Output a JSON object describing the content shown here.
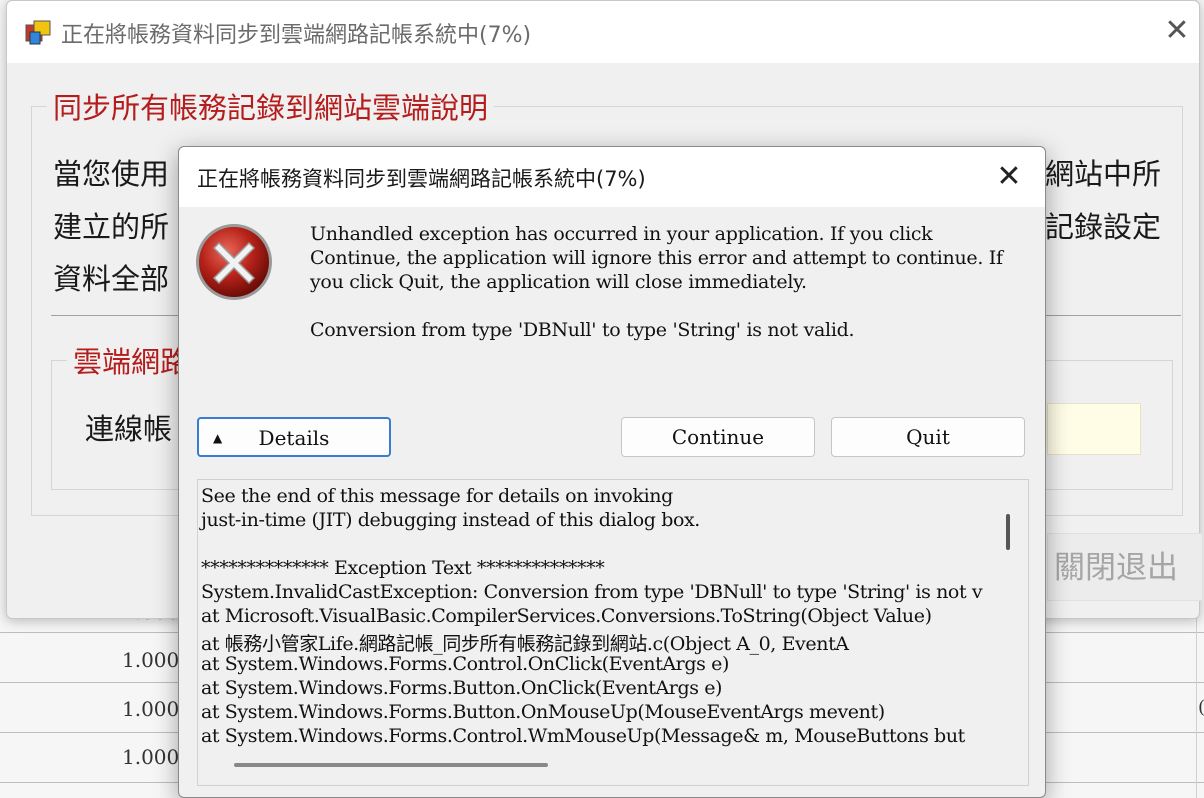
{
  "background": {
    "cells": [
      "1.000",
      "1.000",
      "1.000",
      "1.000"
    ],
    "edge_fragment": "("
  },
  "back_window": {
    "title": "正在將帳務資料同步到雲端網路記帳系統中(7%)",
    "close_glyph": "✕",
    "group_title": "同步所有帳務記錄到網站雲端說明",
    "desc_line1_left": "當您使用",
    "desc_line1_right": "網站中所",
    "desc_line2_left": "建立的所",
    "desc_line2_right": "記錄設定",
    "desc_line3_left": "資料全部",
    "inner_group_title": "雲端網路",
    "account_label": "連線帳",
    "exit_button": "關閉退出"
  },
  "dialog": {
    "title": "正在將帳務資料同步到雲端網路記帳系統中(7%)",
    "close_glyph": "✕",
    "icon": "error-icon",
    "message_lines": [
      "Unhandled exception has occurred in your application. If you click",
      "Continue, the application will ignore this error and attempt to continue. If",
      "you click Quit, the application will close immediately."
    ],
    "error_message": "Conversion from type 'DBNull' to type 'String' is not valid.",
    "details_button": "Details",
    "details_arrow": "▲",
    "continue_button": "Continue",
    "quit_button": "Quit",
    "details_lines": [
      "See the end of this message for details on invoking",
      "just-in-time (JIT) debugging instead of this dialog box.",
      "",
      "************** Exception Text **************",
      "System.InvalidCastException: Conversion from type 'DBNull' to type 'String' is not v",
      "   at Microsoft.VisualBasic.CompilerServices.Conversions.ToString(Object Value)",
      "   at 帳務小管家Life.網路記帳_同步所有帳務記錄到網站.c(Object A_0, EventA",
      "   at System.Windows.Forms.Control.OnClick(EventArgs e)",
      "   at System.Windows.Forms.Button.OnClick(EventArgs e)",
      "   at System.Windows.Forms.Button.OnMouseUp(MouseEventArgs mevent)",
      "   at System.Windows.Forms.Control.WmMouseUp(Message& m, MouseButtons but"
    ]
  },
  "colors": {
    "legend_red": "#b51c1c",
    "focus_blue": "#3a7bd5",
    "dialog_bg": "#f0f0f0"
  }
}
